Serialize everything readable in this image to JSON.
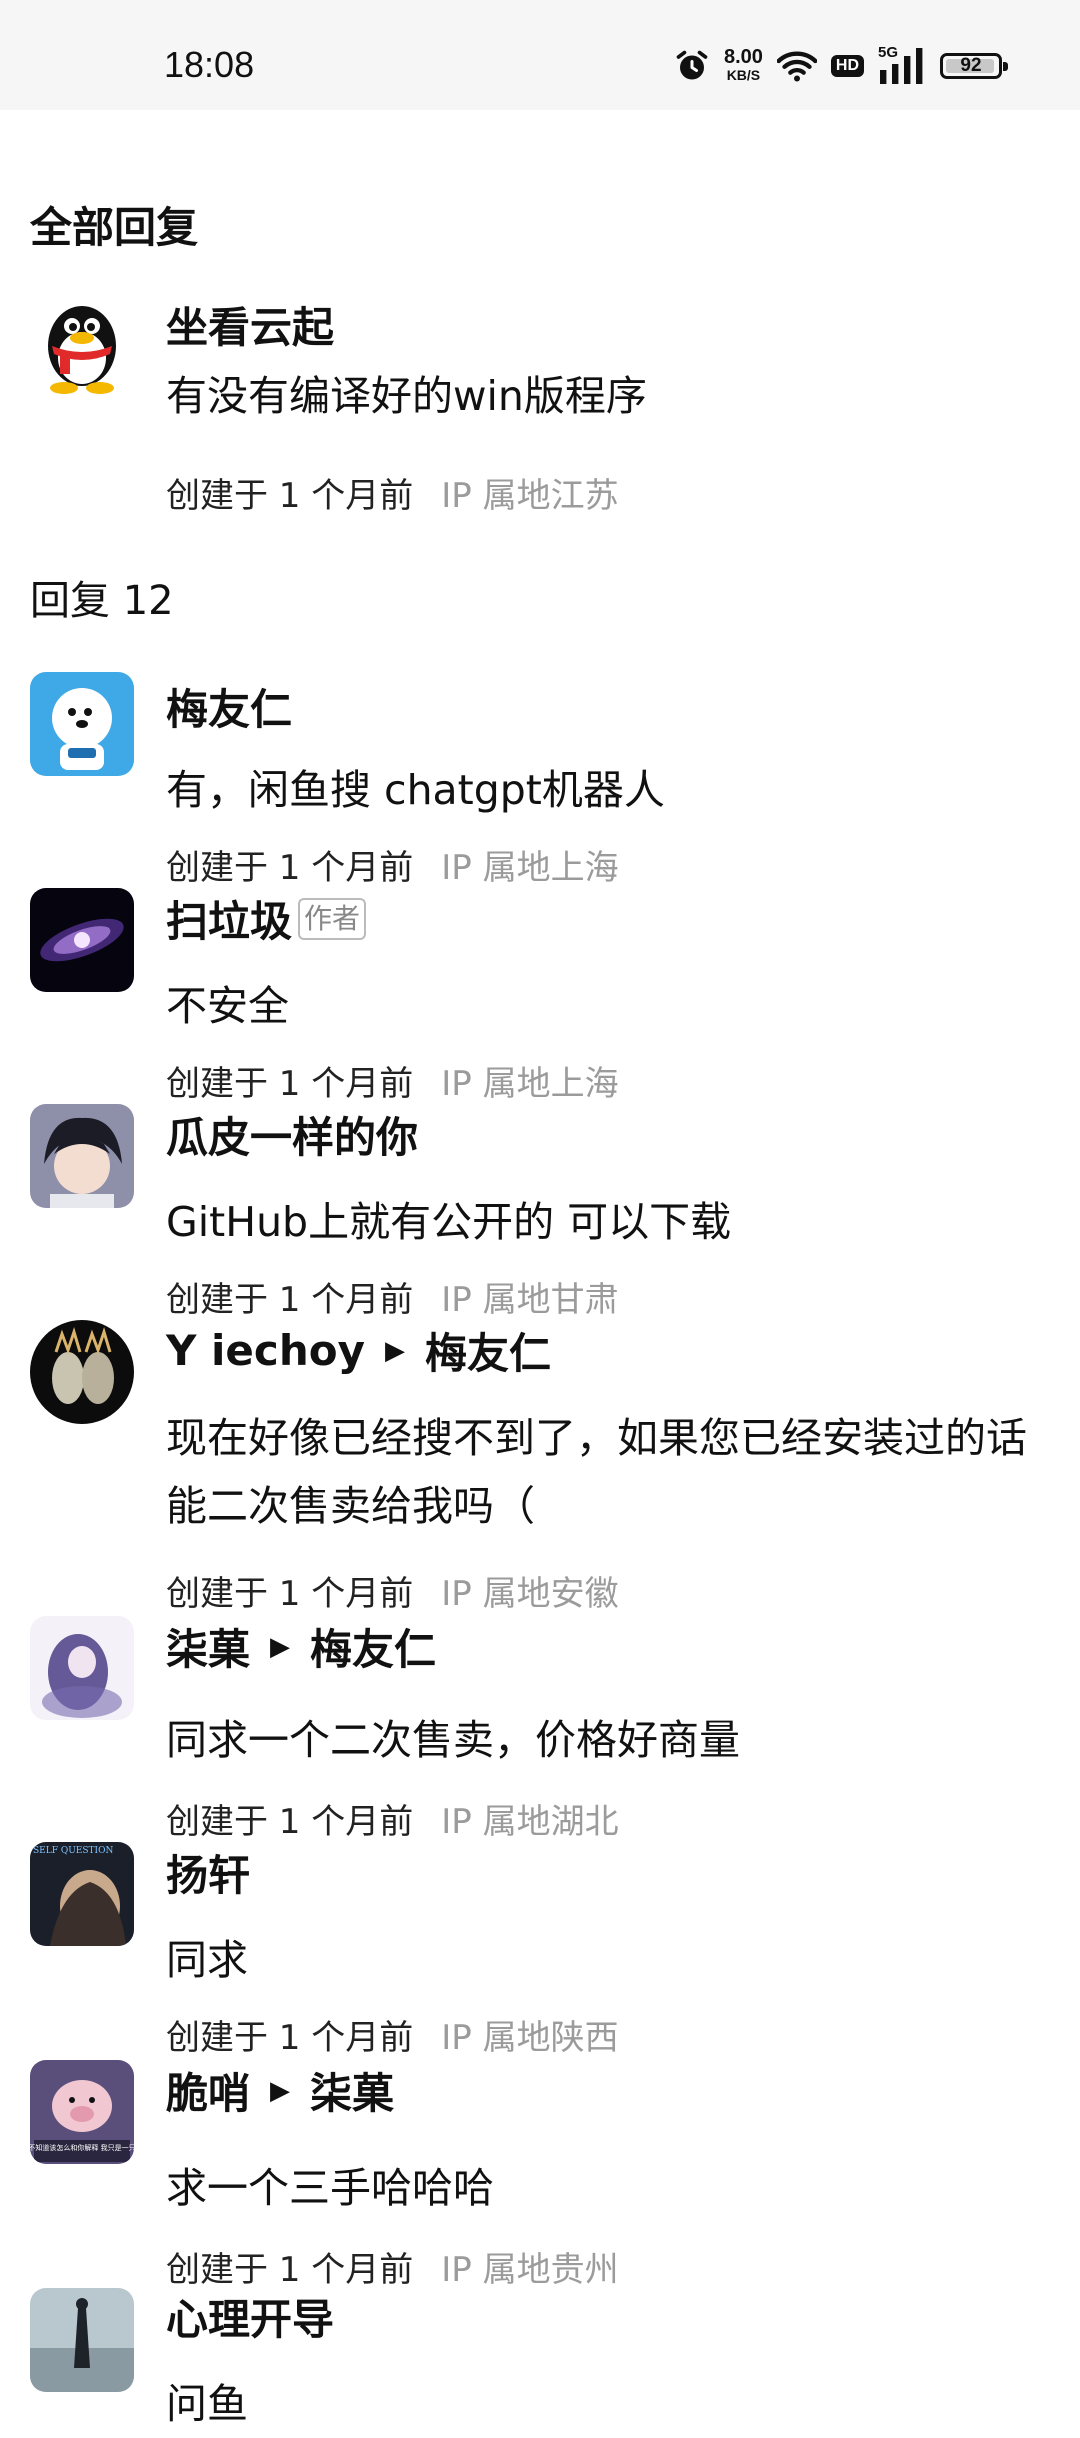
{
  "status_bar": {
    "time": "18:08",
    "net_speed_value": "8.00",
    "net_speed_unit": "KB/S",
    "hd_label": "HD",
    "network_type": "5G",
    "battery_level": "92"
  },
  "section_title": "全部回复",
  "main_comment": {
    "name": "坐看云起",
    "text": "有没有编译好的win版程序",
    "created": "创建于 1 个月前",
    "ip": "IP 属地江苏"
  },
  "reply_count_label": "回复 12",
  "replies": [
    {
      "name": "梅友仁",
      "target": "",
      "badge": "",
      "text": "有，闲鱼搜 chatgpt机器人",
      "created": "创建于 1 个月前",
      "ip": "IP 属地上海"
    },
    {
      "name": "扫垃圾",
      "target": "",
      "badge": "作者",
      "text": "不安全",
      "created": "创建于 1 个月前",
      "ip": "IP 属地上海"
    },
    {
      "name": "瓜皮一样的你",
      "target": "",
      "badge": "",
      "text": "GitHub上就有公开的 可以下载",
      "created": "创建于 1 个月前",
      "ip": "IP 属地甘肃"
    },
    {
      "name": "Y iechoy",
      "target": "梅友仁",
      "badge": "",
      "text": "现在好像已经搜不到了，如果您已经安装过的话能二次售卖给我吗（",
      "created": "创建于 1 个月前",
      "ip": "IP 属地安徽"
    },
    {
      "name": "柒菓",
      "target": "梅友仁",
      "badge": "",
      "text": "同求一个二次售卖，价格好商量",
      "created": "创建于 1 个月前",
      "ip": "IP 属地湖北"
    },
    {
      "name": "扬轩",
      "target": "",
      "badge": "",
      "text": "同求",
      "created": "创建于 1 个月前",
      "ip": "IP 属地陕西"
    },
    {
      "name": "脆哨",
      "target": "柒菓",
      "badge": "",
      "text": "求一个三手哈哈哈",
      "created": "创建于 1 个月前",
      "ip": "IP 属地贵州"
    },
    {
      "name": "心理开导",
      "target": "",
      "badge": "",
      "text": "问鱼",
      "created": "",
      "ip": ""
    }
  ],
  "avatar_captions": {
    "yangxuan": "SELF QUESTION",
    "cuishao": "我不知道该怎么和你解释 我只是一只猪"
  }
}
